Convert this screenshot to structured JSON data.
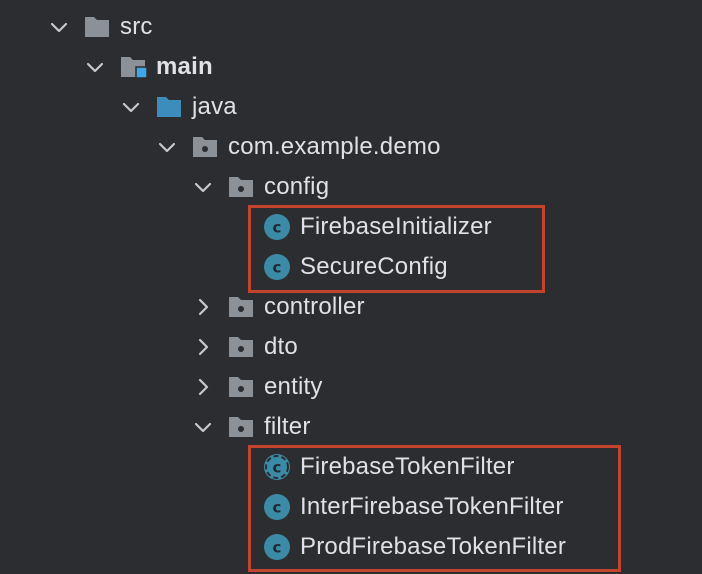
{
  "project_tree": {
    "nodes": [
      {
        "name": "src",
        "kind": "folder",
        "expanded": true
      },
      {
        "name": "main",
        "kind": "source-root-folder",
        "expanded": true
      },
      {
        "name": "java",
        "kind": "java-sources-folder",
        "expanded": true
      },
      {
        "name": "com.example.demo",
        "kind": "package",
        "expanded": true
      },
      {
        "name": "config",
        "kind": "package",
        "expanded": true
      },
      {
        "name": "FirebaseInitializer",
        "kind": "class"
      },
      {
        "name": "SecureConfig",
        "kind": "class"
      },
      {
        "name": "controller",
        "kind": "package",
        "expanded": false
      },
      {
        "name": "dto",
        "kind": "package",
        "expanded": false
      },
      {
        "name": "entity",
        "kind": "package",
        "expanded": false
      },
      {
        "name": "filter",
        "kind": "package",
        "expanded": true
      },
      {
        "name": "FirebaseTokenFilter",
        "kind": "abstract-class"
      },
      {
        "name": "InterFirebaseTokenFilter",
        "kind": "class"
      },
      {
        "name": "ProdFirebaseTokenFilter",
        "kind": "class"
      }
    ],
    "highlight_groups": [
      [
        "FirebaseInitializer",
        "SecureConfig"
      ],
      [
        "FirebaseTokenFilter",
        "InterFirebaseTokenFilter",
        "ProdFirebaseTokenFilter"
      ]
    ]
  },
  "colors": {
    "background": "#2b2d30",
    "text": "#dfe1e5",
    "folder_icon": "#8c9198",
    "java_folder_icon": "#3c8dbc",
    "module_marker": "#3fa6e8",
    "class_icon_bg": "#3b8aa6",
    "class_icon_letter": "#1e2a30",
    "chevron": "#c4c7cc",
    "highlight_border": "#c4432f"
  }
}
